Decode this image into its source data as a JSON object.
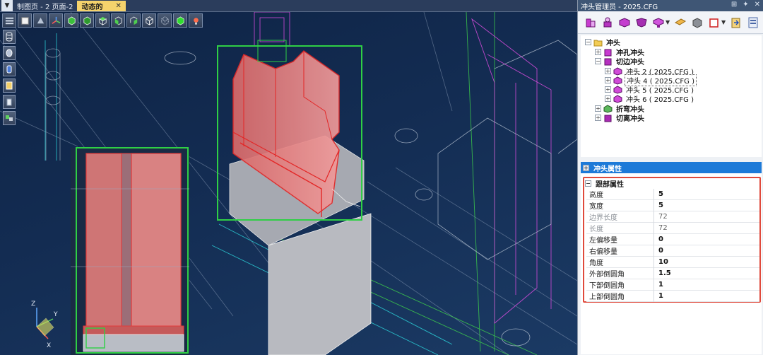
{
  "document_tabs": [
    {
      "label": "制图页 - 2 页面-2",
      "active": false
    },
    {
      "label": "动态的",
      "active": true,
      "close": "✕"
    }
  ],
  "viewport_toolbar": {
    "view_icons": [
      "menu-icon",
      "fit-view-icon",
      "pan-view-icon",
      "axis-view-icon",
      "cube-front-icon",
      "cube-back-icon",
      "cube-top-icon",
      "cube-left-icon",
      "cube-right-icon",
      "cube-iso-icon",
      "cube-wire-icon",
      "cube-shaded-icon",
      "light-icon"
    ],
    "side_icons": [
      "shape-cylinder-icon",
      "shape-disc-icon",
      "shape-tube-icon",
      "shape-box-icon",
      "shape-panel-icon",
      "view-cube-icon"
    ]
  },
  "axis_labels": {
    "z": "Z",
    "y": "Y",
    "x": "X"
  },
  "panel": {
    "title": "冲头管理员 - 2025.CFG",
    "title_icons": {
      "pin": "⊞",
      "dock": "✦",
      "close": "✕"
    },
    "toolbar_icons": [
      "punch-add-icon",
      "punch-hole-icon",
      "punch-edge-icon",
      "punch-bend-icon",
      "punch-cut-icon",
      "punch-dropdown-icon",
      "slide-tool-icon",
      "cube-tool-icon",
      "box-select-icon",
      "box-dropdown-icon",
      "export-icon",
      "settings-doc-icon"
    ],
    "tree": {
      "root": "冲头",
      "children": [
        {
          "label": "冲孔冲头",
          "expander": "+"
        },
        {
          "label": "切边冲头",
          "expander": "−",
          "children": [
            {
              "label": "冲头 2 ( 2025.CFG )"
            },
            {
              "label": "冲头 4 ( 2025.CFG )",
              "focused": true
            },
            {
              "label": "冲头 5 ( 2025.CFG )"
            },
            {
              "label": "冲头 6 ( 2025.CFG )"
            }
          ]
        },
        {
          "label": "折弯冲头",
          "expander": "+"
        },
        {
          "label": "切离冲头",
          "expander": "+"
        }
      ]
    },
    "properties": {
      "title": "冲头属性",
      "title_expander": "+",
      "group": "跟部属性",
      "group_expander": "−",
      "rows": [
        {
          "name": "高度",
          "value": "5"
        },
        {
          "name": "宽度",
          "value": "5"
        },
        {
          "name": "边界长度",
          "value": "72",
          "muted": true
        },
        {
          "name": "长度",
          "value": "72",
          "muted": true
        },
        {
          "name": "左偏移量",
          "value": "0"
        },
        {
          "name": "右偏移量",
          "value": "0"
        },
        {
          "name": "角度",
          "value": "10"
        },
        {
          "name": "外部倒圆角",
          "value": "1.5"
        },
        {
          "name": "下部倒圆角",
          "value": "1"
        },
        {
          "name": "上部倒圆角",
          "value": "1"
        }
      ]
    }
  },
  "colors": {
    "highlight": "#e04a3c",
    "selection_green": "#2fcf45",
    "punch_red": "#e55a5a",
    "property_header": "#1d7ad8"
  }
}
